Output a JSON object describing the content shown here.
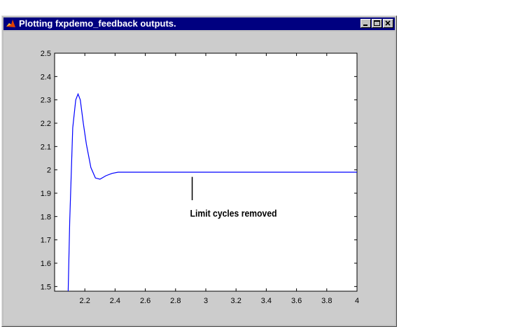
{
  "window": {
    "title": "Plotting fxpdemo_feedback outputs.",
    "title_bar_color": "#000080",
    "background_color": "#cccccc",
    "buttons": [
      "minimize-icon",
      "maximize-icon",
      "close-icon"
    ]
  },
  "annotation": {
    "text": "Limit cycles removed",
    "x": 2.91
  },
  "chart_data": {
    "type": "line",
    "title": "",
    "xlabel": "",
    "ylabel": "",
    "xlim": [
      2.0,
      4.0
    ],
    "ylim": [
      1.48,
      2.5
    ],
    "xticks": [
      2.2,
      2.4,
      2.6,
      2.8,
      3.0,
      3.2,
      3.4,
      3.6,
      3.8,
      4.0
    ],
    "xtick_labels": [
      "2.2",
      "2.4",
      "2.6",
      "2.8",
      "3",
      "3.2",
      "3.4",
      "3.6",
      "3.8",
      "4"
    ],
    "yticks": [
      1.5,
      1.6,
      1.7,
      1.8,
      1.9,
      2.0,
      2.1,
      2.2,
      2.3,
      2.4,
      2.5
    ],
    "ytick_labels": [
      "1.5",
      "1.6",
      "1.7",
      "1.8",
      "1.9",
      "2",
      "2.1",
      "2.2",
      "2.3",
      "2.4",
      "2.5"
    ],
    "grid": false,
    "line_color": "#0000ff",
    "series": [
      {
        "x": [
          2.09,
          2.1,
          2.12,
          2.14,
          2.155,
          2.17,
          2.19,
          2.21,
          2.24,
          2.27,
          2.3,
          2.34,
          2.38,
          2.42,
          2.46,
          2.5,
          2.6,
          2.8,
          3.0,
          3.2,
          3.4,
          3.6,
          3.8,
          4.0
        ],
        "y": [
          1.48,
          1.78,
          2.18,
          2.3,
          2.325,
          2.3,
          2.2,
          2.11,
          2.01,
          1.965,
          1.96,
          1.975,
          1.985,
          1.99,
          1.99,
          1.99,
          1.99,
          1.99,
          1.99,
          1.99,
          1.99,
          1.99,
          1.99,
          1.99
        ]
      }
    ]
  }
}
